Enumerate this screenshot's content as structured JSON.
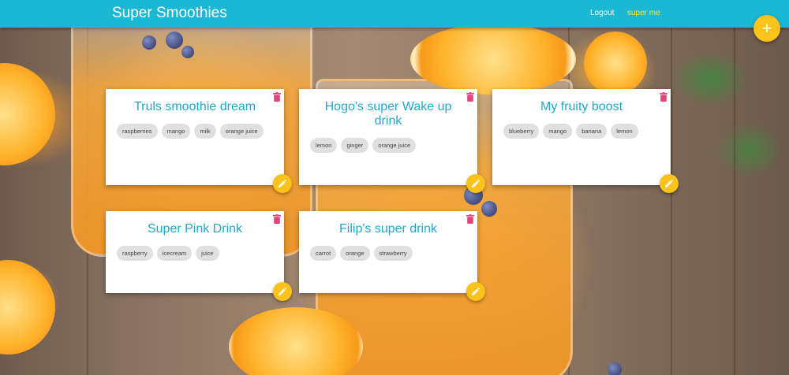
{
  "app": {
    "title": "Super Smoothies"
  },
  "nav": {
    "logout_label": "Logout",
    "user_label": "super me"
  },
  "add_button": {
    "icon": "plus-icon",
    "label": "+"
  },
  "colors": {
    "topbar": "#1ab8d2",
    "accent": "#fbc21a",
    "title": "#21a9c9",
    "delete": "#e0457b",
    "user_link": "#ffe533"
  },
  "cards": [
    {
      "title": "Truls smoothie dream",
      "ingredients": [
        "raspberries",
        "mango",
        "milk",
        "orange juice"
      ]
    },
    {
      "title": "Hogo's super Wake up drink",
      "ingredients": [
        "lemon",
        "ginger",
        "orange juice"
      ]
    },
    {
      "title": "My fruity boost",
      "ingredients": [
        "blueberry",
        "mango",
        "banana",
        "lemon"
      ]
    },
    {
      "title": "Super Pink Drink",
      "ingredients": [
        "raspberry",
        "icecream",
        "juice"
      ]
    },
    {
      "title": "Filip's super drink",
      "ingredients": [
        "carrot",
        "orange",
        "strawberry"
      ]
    }
  ]
}
